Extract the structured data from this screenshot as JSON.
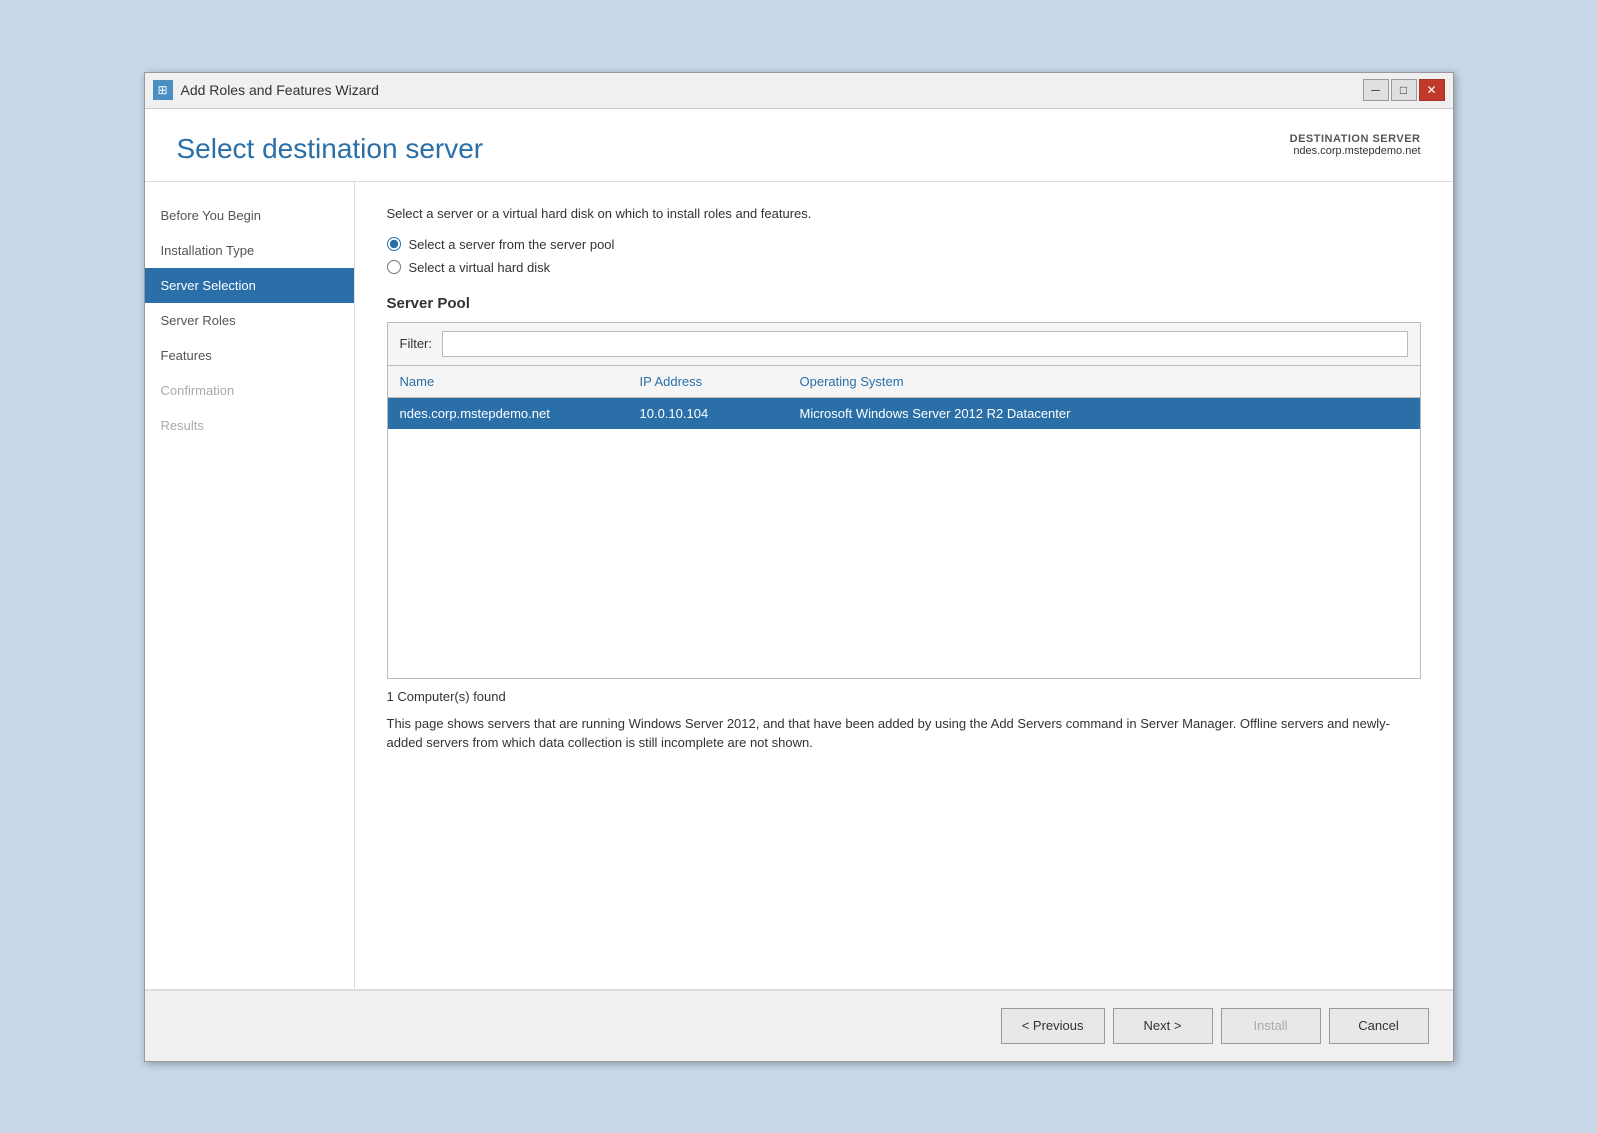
{
  "window": {
    "title": "Add Roles and Features Wizard",
    "icon": "⊞",
    "controls": {
      "minimize": "─",
      "maximize": "□",
      "close": "✕"
    }
  },
  "header": {
    "main_title": "Select destination server",
    "destination_server_label": "DESTINATION SERVER",
    "destination_server_name": "ndes.corp.mstepdemo.net"
  },
  "sidebar": {
    "items": [
      {
        "label": "Before You Begin",
        "state": "normal"
      },
      {
        "label": "Installation Type",
        "state": "normal"
      },
      {
        "label": "Server Selection",
        "state": "active"
      },
      {
        "label": "Server Roles",
        "state": "normal"
      },
      {
        "label": "Features",
        "state": "normal"
      },
      {
        "label": "Confirmation",
        "state": "disabled"
      },
      {
        "label": "Results",
        "state": "disabled"
      }
    ]
  },
  "main": {
    "instruction": "Select a server or a virtual hard disk on which to install roles and features.",
    "radio_options": [
      {
        "label": "Select a server from the server pool",
        "checked": true
      },
      {
        "label": "Select a virtual hard disk",
        "checked": false
      }
    ],
    "server_pool": {
      "title": "Server Pool",
      "filter_label": "Filter:",
      "filter_placeholder": "",
      "table": {
        "columns": [
          {
            "label": "Name"
          },
          {
            "label": "IP Address"
          },
          {
            "label": "Operating System"
          }
        ],
        "rows": [
          {
            "name": "ndes.corp.mstepdemo.net",
            "ip": "10.0.10.104",
            "os": "Microsoft Windows Server 2012 R2 Datacenter",
            "selected": true
          }
        ]
      }
    },
    "computers_found": "1 Computer(s) found",
    "description": "This page shows servers that are running Windows Server 2012, and that have been added by using the Add Servers command in Server Manager. Offline servers and newly-added servers from which data collection is still incomplete are not shown."
  },
  "footer": {
    "previous_label": "< Previous",
    "next_label": "Next >",
    "install_label": "Install",
    "cancel_label": "Cancel"
  }
}
